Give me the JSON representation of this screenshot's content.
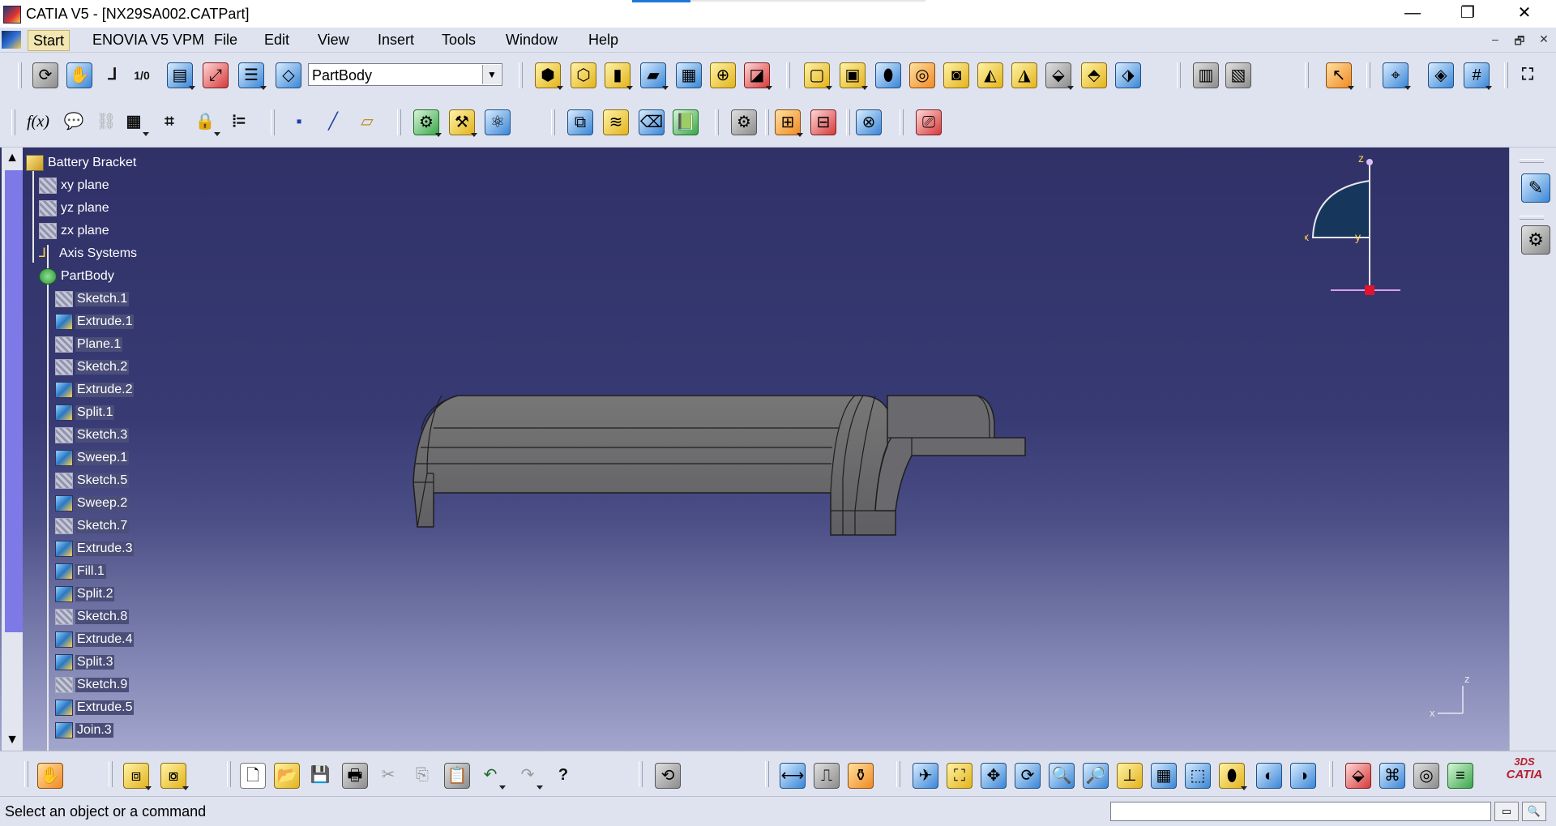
{
  "window": {
    "title": "CATIA V5 - [NX29SA002.CATPart]",
    "controls": {
      "minimize": "—",
      "restore": "❐",
      "close": "✕"
    }
  },
  "menu": {
    "items": [
      {
        "id": "start",
        "label": "Start"
      },
      {
        "id": "enovia",
        "label": "ENOVIA V5 VPM"
      },
      {
        "id": "file",
        "label": "File"
      },
      {
        "id": "edit",
        "label": "Edit"
      },
      {
        "id": "view",
        "label": "View"
      },
      {
        "id": "insert",
        "label": "Insert"
      },
      {
        "id": "tools",
        "label": "Tools"
      },
      {
        "id": "window",
        "label": "Window"
      },
      {
        "id": "help",
        "label": "Help"
      }
    ],
    "mdi_controls": {
      "minimize": "–",
      "restore": "🗗",
      "close": "✕"
    }
  },
  "toolbar": {
    "body_selector": {
      "selected": "PartBody",
      "arrow": "▼"
    },
    "function_label": "f(x)"
  },
  "tree": {
    "root": "Battery Bracket",
    "items": [
      {
        "label": "xy plane"
      },
      {
        "label": "yz plane"
      },
      {
        "label": "zx plane"
      },
      {
        "label": "Axis Systems"
      },
      {
        "label": "PartBody"
      },
      {
        "label": "Sketch.1"
      },
      {
        "label": "Extrude.1"
      },
      {
        "label": "Plane.1"
      },
      {
        "label": "Sketch.2"
      },
      {
        "label": "Extrude.2"
      },
      {
        "label": "Split.1"
      },
      {
        "label": "Sketch.3"
      },
      {
        "label": "Sweep.1"
      },
      {
        "label": "Sketch.5"
      },
      {
        "label": "Sweep.2"
      },
      {
        "label": "Sketch.7"
      },
      {
        "label": "Extrude.3"
      },
      {
        "label": "Fill.1"
      },
      {
        "label": "Split.2"
      },
      {
        "label": "Sketch.8"
      },
      {
        "label": "Extrude.4"
      },
      {
        "label": "Split.3"
      },
      {
        "label": "Sketch.9"
      },
      {
        "label": "Extrude.5"
      },
      {
        "label": "Join.3"
      }
    ],
    "scroll_up": "▲",
    "scroll_down": "▼"
  },
  "compass": {
    "x_label": "x",
    "y_label": "y",
    "z_label": "z"
  },
  "triad": {
    "x_label": "x",
    "z_label": "z"
  },
  "brand": {
    "logo_text": "CATIA",
    "mark": "3DS"
  },
  "status": {
    "message": "Select an object or a command"
  },
  "colors": {
    "viewport_top": "#2f3167",
    "viewport_bottom": "#a3a6cc",
    "model_face": "#6e6e72",
    "tree_highlight": "#4a4e78",
    "compass_accent": "#ffd24a",
    "compass_origin": "#e0142d"
  }
}
